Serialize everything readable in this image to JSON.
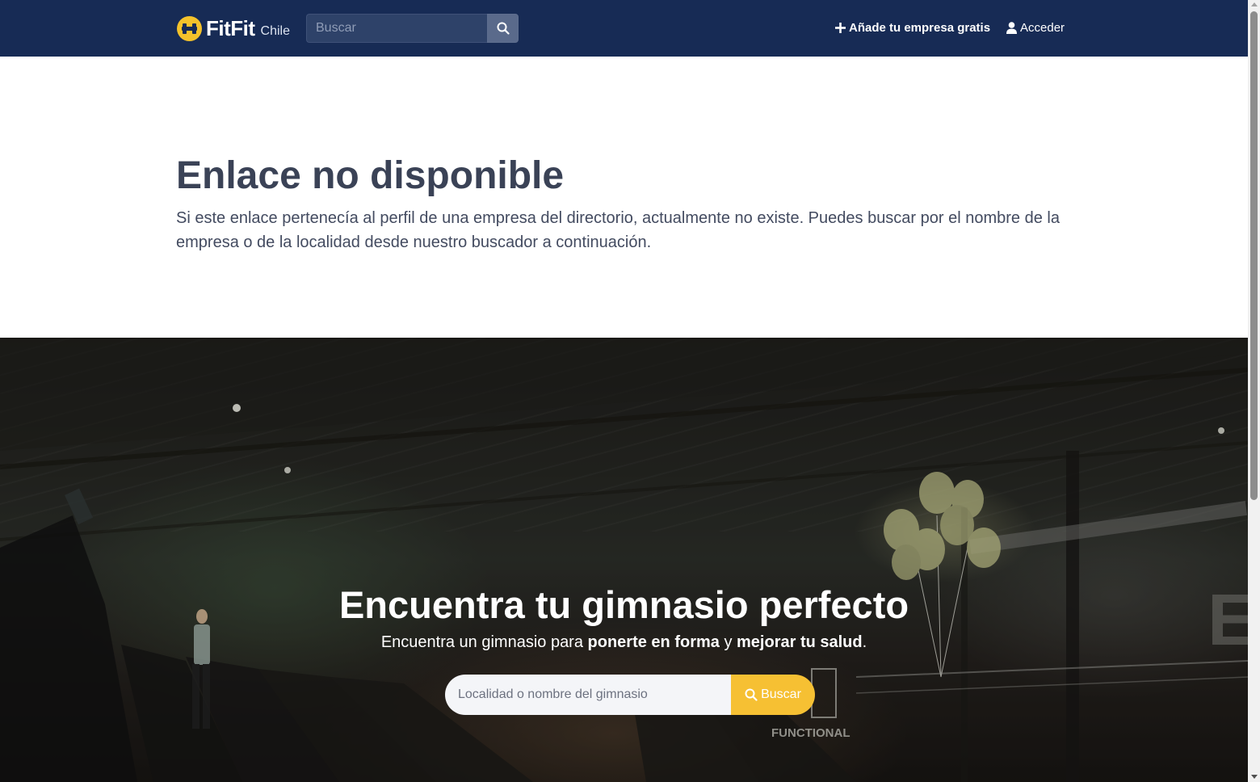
{
  "navbar": {
    "brand_name": "FitFit",
    "brand_country": "Chile",
    "search_placeholder": "Buscar",
    "add_company_label": "Añade tu empresa gratis",
    "login_label": "Acceder",
    "icons": [
      "dumbbell-logo-icon",
      "search-icon",
      "plus-icon",
      "user-icon"
    ]
  },
  "error": {
    "title": "Enlace no disponible",
    "text": "Si este enlace pertenecía al perfil de una empresa del directorio, actualmente no existe. Puedes buscar por el nombre de la empresa o de la localidad desde nuestro buscador a continuación."
  },
  "hero": {
    "title": "Encuentra tu gimnasio perfecto",
    "subtitle_prefix": "Encuentra un gimnasio para ",
    "subtitle_bold_1": "ponerte en forma",
    "subtitle_mid": " y ",
    "subtitle_bold_2": "mejorar tu salud",
    "subtitle_suffix": ".",
    "search_placeholder": "Localidad o nombre del gimnasio",
    "search_button_label": "Buscar"
  },
  "colors": {
    "navbar_bg": "#172b55",
    "brand_yellow": "#f4c22b",
    "search_button_yellow": "#f6c033",
    "heading_text": "#3a4256"
  }
}
